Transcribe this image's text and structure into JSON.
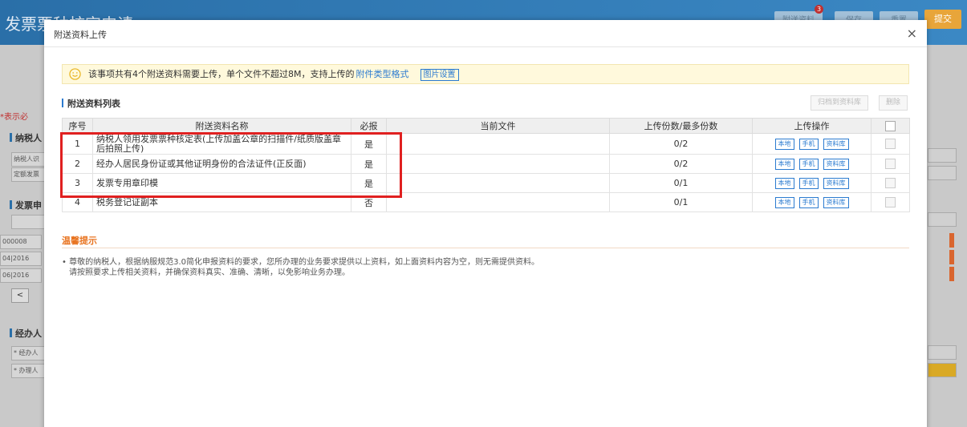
{
  "background": {
    "title": "发票票种核定申请",
    "header_buttons": [
      "附送资料",
      "保存",
      "重置"
    ],
    "submit_label": "提交",
    "badge_count": "3",
    "required_note": "*表示必",
    "section_taxpayer": "纳税人",
    "taxpayer_rows": [
      "纳税人识",
      "定额发票"
    ],
    "section_invoice": "发票申",
    "invoice_rows": [
      "000008",
      "04|2016",
      "06|2016"
    ],
    "pager_prev": "<",
    "section_agent": "经办人",
    "agent_rows": [
      "* 经办人",
      "* 办理人"
    ]
  },
  "dialog": {
    "title": "附送资料上传",
    "close_label": "×",
    "notice": {
      "text": "该事项共有4个附送资料需要上传，单个文件不超过8M，支持上传的",
      "link": "附件类型格式",
      "pic_button": "图片设置"
    },
    "list_title": "附送资料列表",
    "archive_button": "归档到资料库",
    "delete_button": "删除",
    "columns": [
      "序号",
      "附送资料名称",
      "必报",
      "当前文件",
      "上传份数/最多份数",
      "上传操作"
    ],
    "rows": [
      {
        "no": "1",
        "name": "纳税人领用发票票种核定表(上传加盖公章的扫描件/纸质版盖章后拍照上传)",
        "required": "是",
        "file": "",
        "count": "0/2"
      },
      {
        "no": "2",
        "name": "经办人居民身份证或其他证明身份的合法证件(正反面)",
        "required": "是",
        "file": "",
        "count": "0/2"
      },
      {
        "no": "3",
        "name": "发票专用章印模",
        "required": "是",
        "file": "",
        "count": "0/1"
      },
      {
        "no": "4",
        "name": "税务登记证副本",
        "required": "否",
        "file": "",
        "count": "0/1"
      }
    ],
    "op_labels": {
      "local": "本地",
      "phone": "手机",
      "library": "资料库"
    },
    "tips_title": "温馨提示",
    "tips_line1": "• 尊敬的纳税人，根据纳服规范3.0简化申报资料的要求，您所办理的业务要求提供以上资料，如上面资料内容为空，则无需提供资料。",
    "tips_line2": "请按照要求上传相关资料，并确保资料真实、准确、清晰，以免影响业务办理。"
  },
  "colors": {
    "accent": "#2b7bd0",
    "highlight": "#e02020",
    "notice_bg": "#fff9dc",
    "tips_title": "#e8731f",
    "submit": "#e8a53a"
  }
}
